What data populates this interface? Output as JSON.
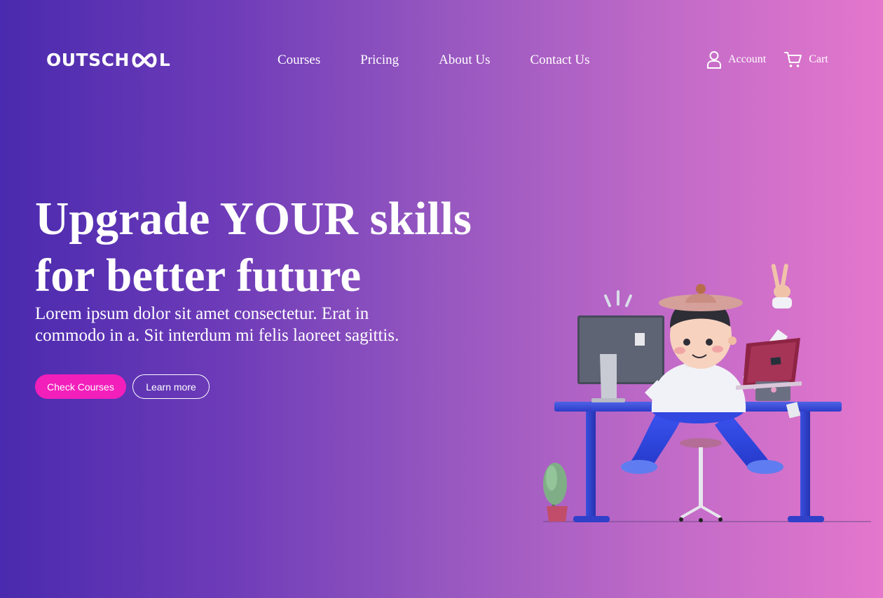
{
  "header": {
    "logo_text_left": "OUTSCH",
    "logo_text_right": "L",
    "nav": [
      "Courses",
      "Pricing",
      "About Us",
      "Contact Us"
    ],
    "account_label": "Account",
    "cart_label": "Cart"
  },
  "hero": {
    "title_line1": "Upgrade YOUR skills",
    "title_line2": "for better future",
    "subtitle": "Lorem ipsum dolor sit amet consectetur. Erat in commodo in a. Sit interdum mi felis laoreet sagittis.",
    "primary_button": "Check Courses",
    "secondary_button": "Learn more"
  },
  "colors": {
    "gradient_start": "#4a2aae",
    "gradient_end": "#e477cc",
    "primary_button": "#f21fbb",
    "text": "#ffffff"
  },
  "icons": {
    "account": "user-icon",
    "cart": "shopping-cart-icon",
    "logo": "infinity-icon"
  }
}
